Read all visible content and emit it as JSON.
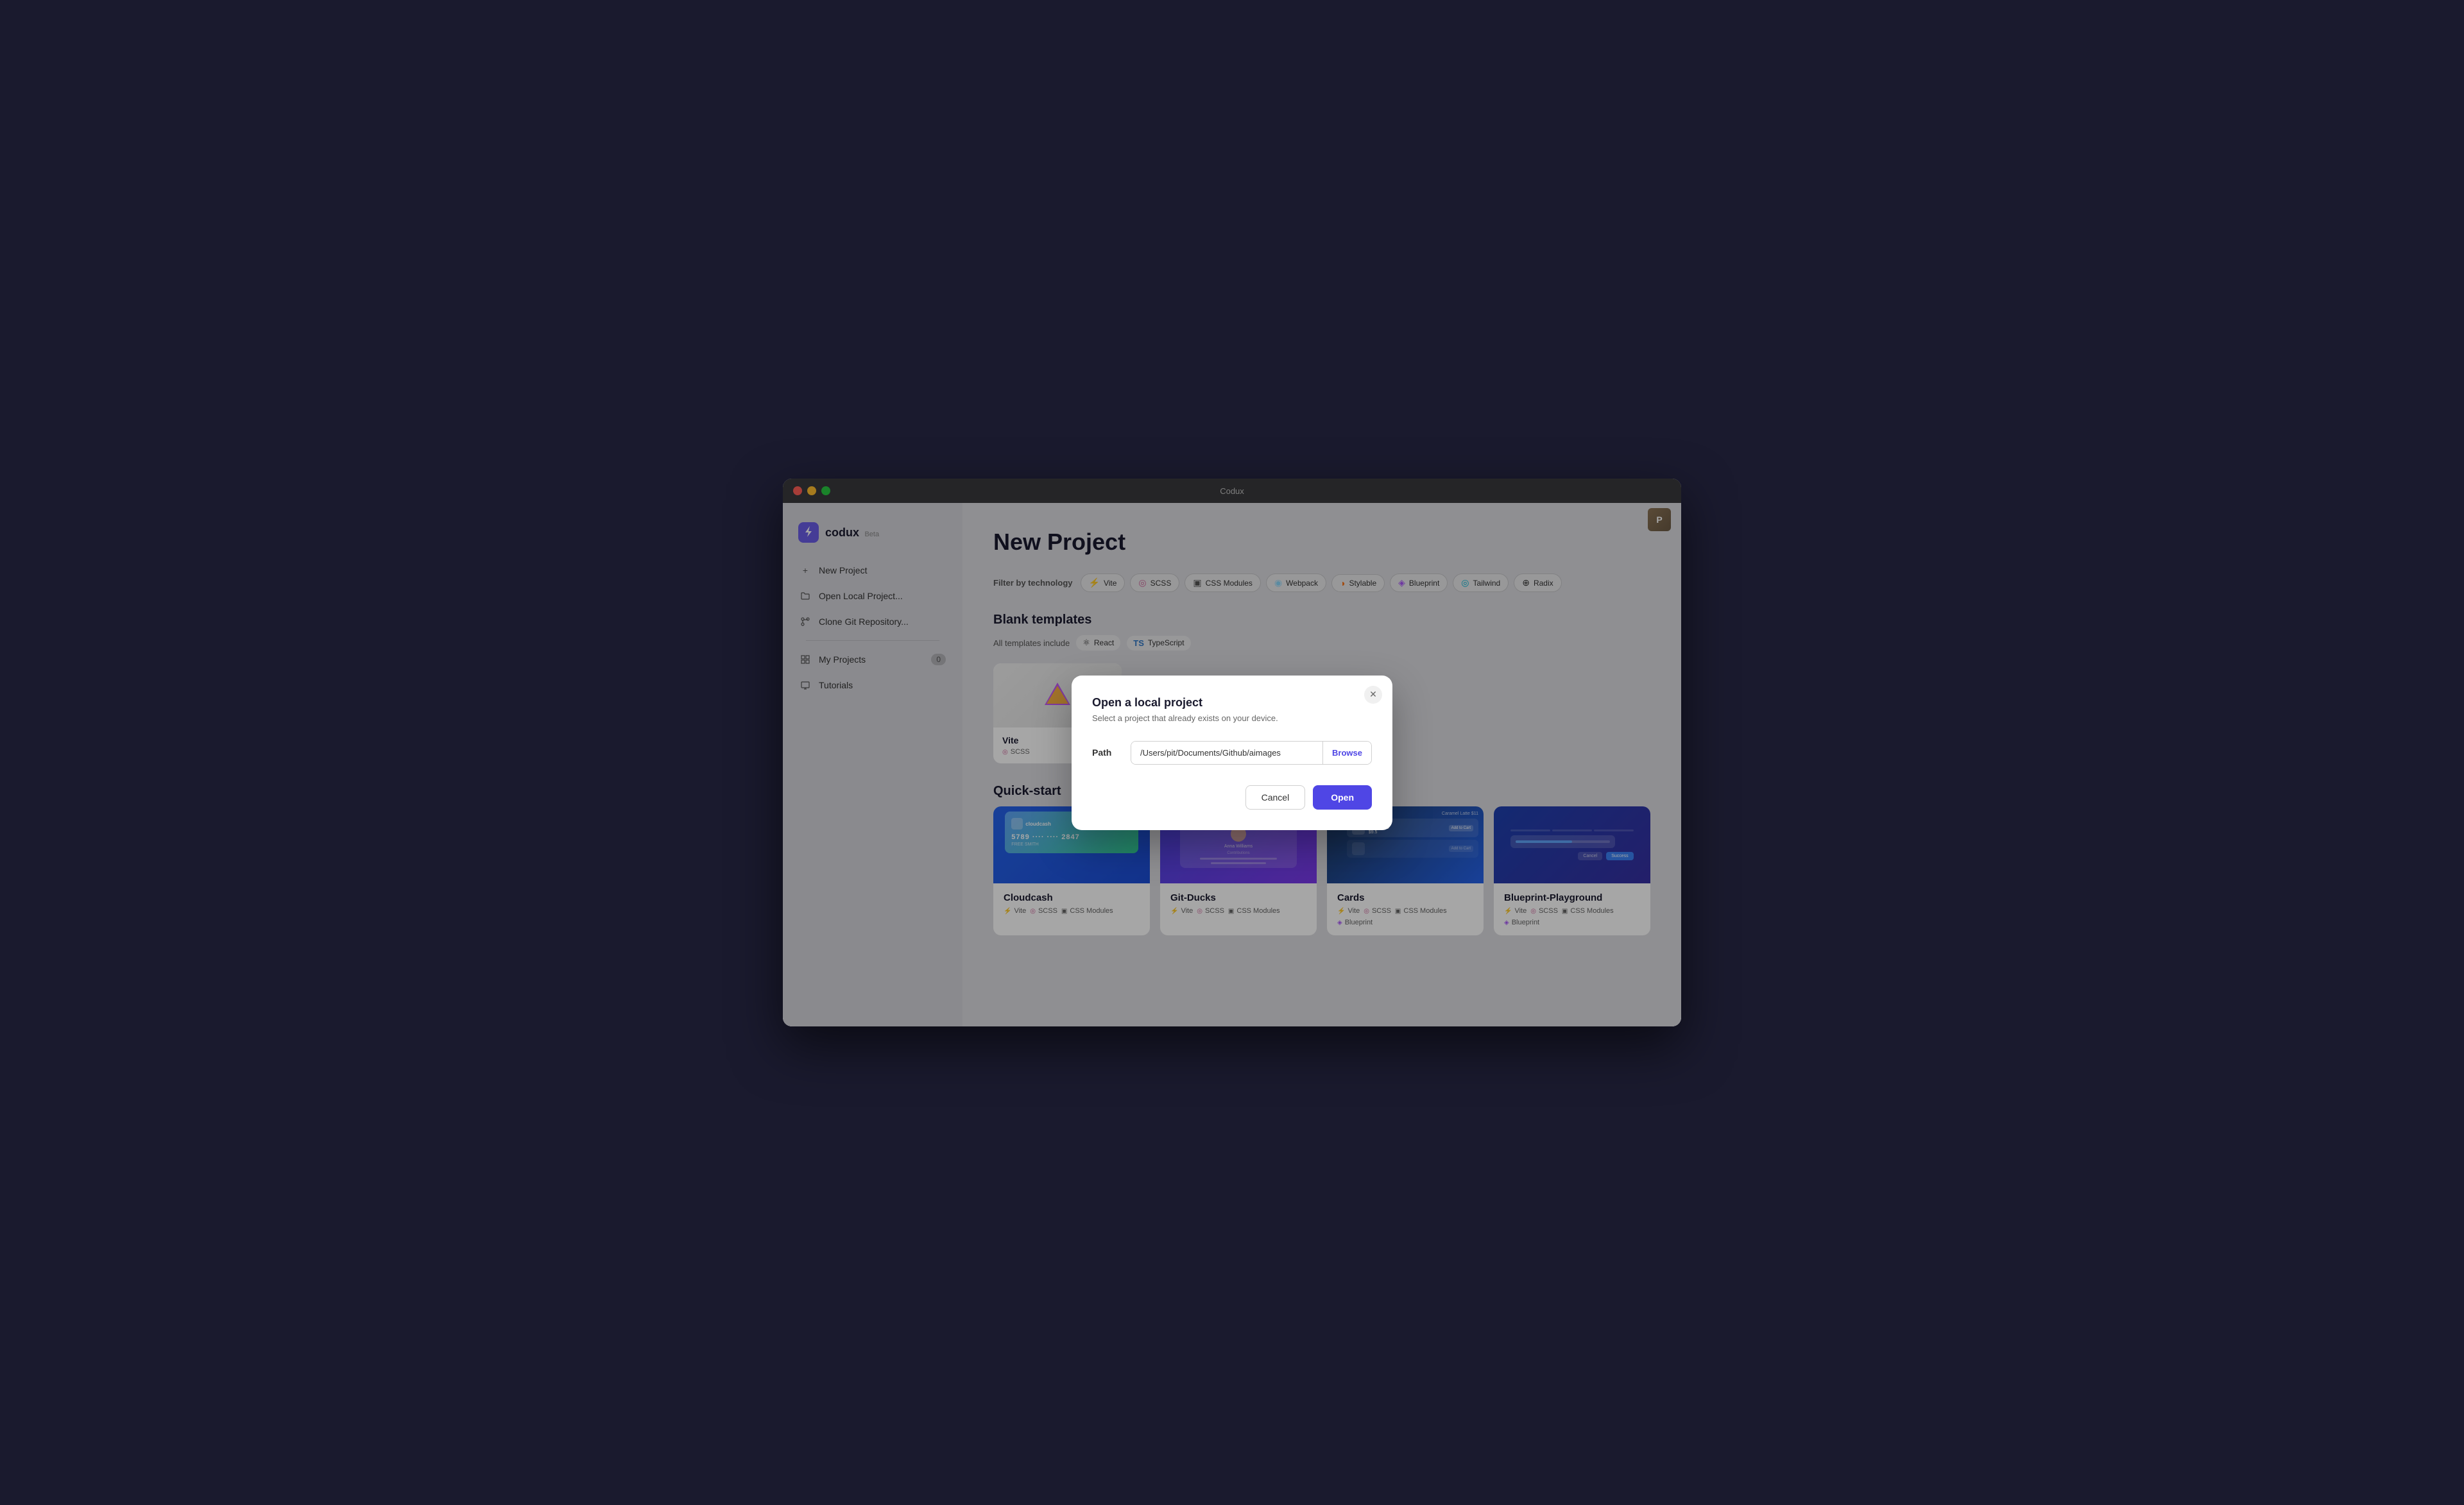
{
  "window": {
    "title": "Codux"
  },
  "app": {
    "logo_text": "codux",
    "logo_beta": "Beta"
  },
  "sidebar": {
    "items": [
      {
        "id": "new-project",
        "label": "New Project",
        "icon": "+"
      },
      {
        "id": "open-local",
        "label": "Open Local Project...",
        "icon": "□"
      },
      {
        "id": "clone-git",
        "label": "Clone Git Repository...",
        "icon": "⑂"
      },
      {
        "id": "my-projects",
        "label": "My Projects",
        "icon": "⊞",
        "badge": "0"
      },
      {
        "id": "tutorials",
        "label": "Tutorials",
        "icon": "□"
      }
    ]
  },
  "main": {
    "page_title": "New Project",
    "filter_label": "Filter by technology",
    "filters": [
      {
        "id": "vite",
        "label": "Vite",
        "icon": "⚡"
      },
      {
        "id": "scss",
        "label": "SCSS",
        "icon": "◎"
      },
      {
        "id": "css-modules",
        "label": "CSS Modules",
        "icon": "▣"
      },
      {
        "id": "webpack",
        "label": "Webpack",
        "icon": "◉"
      },
      {
        "id": "stylable",
        "label": "Stylable",
        "icon": "◑"
      },
      {
        "id": "blueprint",
        "label": "Blueprint",
        "icon": "◈"
      },
      {
        "id": "tailwind",
        "label": "Tailwind",
        "icon": "◎"
      },
      {
        "id": "radix",
        "label": "Radix",
        "icon": "⊕"
      }
    ],
    "blank_section": {
      "title": "Blank templates",
      "includes_label": "All templates include",
      "includes": [
        {
          "label": "React",
          "icon": "⚛"
        },
        {
          "label": "TypeScript",
          "icon": "🅣"
        }
      ]
    },
    "blank_templates": [
      {
        "name": "Vite",
        "icon": "⚡",
        "tags": [
          "SCSS"
        ]
      }
    ],
    "quick_start_title": "Quick-start",
    "quick_start_cards": [
      {
        "name": "Cloudcash",
        "tags": [
          "Vite",
          "SCSS",
          "CSS Modules"
        ]
      },
      {
        "name": "Git-Ducks",
        "tags": [
          "Vite",
          "SCSS",
          "CSS Modules"
        ]
      },
      {
        "name": "Cards",
        "tags": [
          "Vite",
          "SCSS",
          "CSS Modules",
          "Blueprint"
        ]
      },
      {
        "name": "Blueprint-Playground",
        "tags": [
          "Vite",
          "SCSS",
          "CSS Modules",
          "Blueprint"
        ]
      }
    ]
  },
  "modal": {
    "title": "Open a local project",
    "subtitle": "Select a project that already exists on your device.",
    "path_label": "Path",
    "path_value": "/Users/pit/Documents/Github/aimages",
    "browse_label": "Browse",
    "cancel_label": "Cancel",
    "open_label": "Open"
  }
}
